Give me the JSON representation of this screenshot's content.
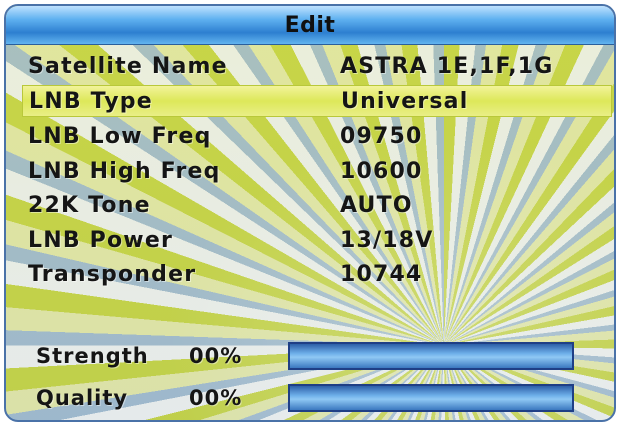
{
  "title": "Edit",
  "fields": [
    {
      "label": "Satellite Name",
      "value": "ASTRA 1E,1F,1G"
    },
    {
      "label": "LNB Type",
      "value": "Universal"
    },
    {
      "label": "LNB Low Freq",
      "value": "09750"
    },
    {
      "label": "LNB High Freq",
      "value": "10600"
    },
    {
      "label": "22K Tone",
      "value": "AUTO"
    },
    {
      "label": "LNB Power",
      "value": "13/18V"
    },
    {
      "label": "Transponder",
      "value": "10744"
    }
  ],
  "signal": {
    "strength": {
      "label": "Strength",
      "percent_text": "00%",
      "level": 0
    },
    "quality": {
      "label": "Quality",
      "percent_text": "00%",
      "level": 0
    }
  },
  "colors": {
    "title_bar": "#2d7fd0",
    "selection": "#dde85a",
    "bar": "#6fb0ea"
  }
}
